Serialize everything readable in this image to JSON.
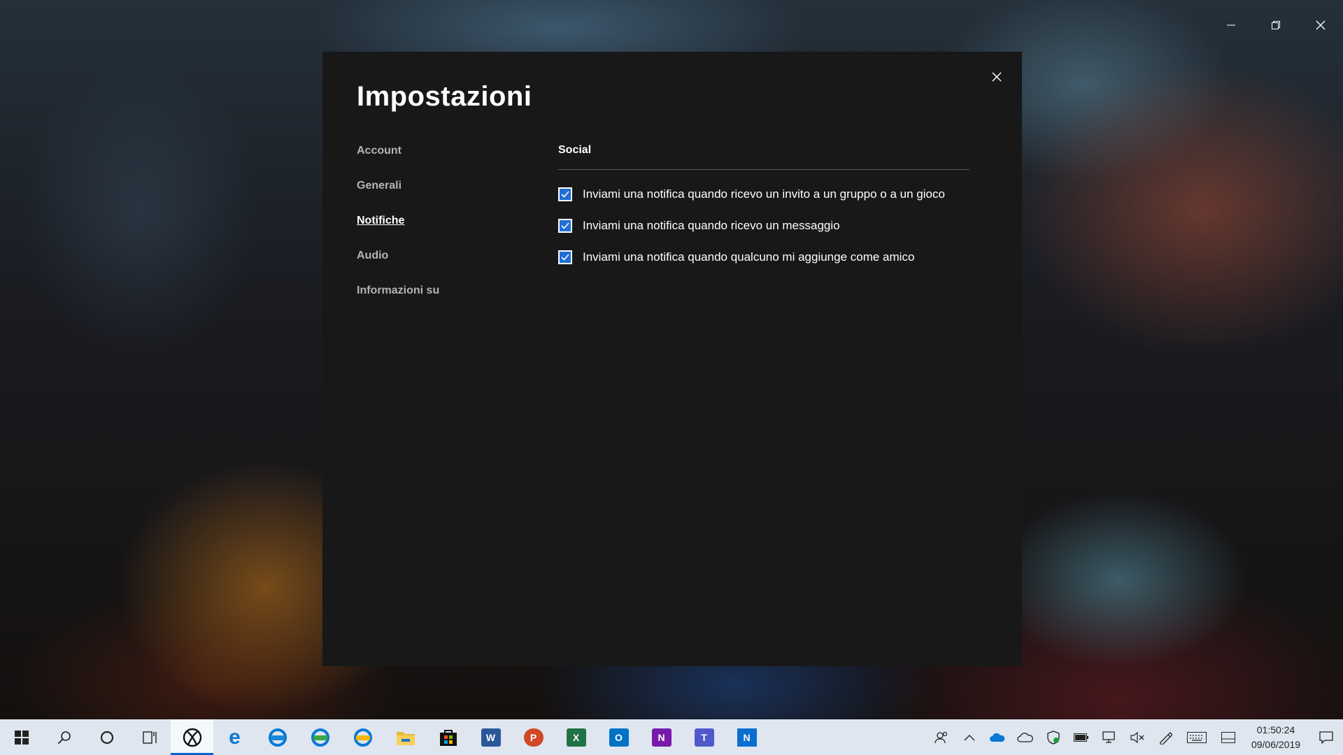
{
  "dialog": {
    "title": "Impostazioni",
    "nav": [
      {
        "label": "Account"
      },
      {
        "label": "Generali"
      },
      {
        "label": "Notifiche",
        "active": true
      },
      {
        "label": "Audio"
      },
      {
        "label": "Informazioni su"
      }
    ],
    "section": {
      "title": "Social",
      "options": [
        {
          "label": "Inviami una notifica quando ricevo un invito a un gruppo o a un gioco",
          "checked": true
        },
        {
          "label": "Inviami una notifica quando ricevo un messaggio",
          "checked": true
        },
        {
          "label": "Inviami una notifica quando qualcuno mi aggiunge come amico",
          "checked": true
        }
      ]
    }
  },
  "taskbar": {
    "apps": [
      {
        "name": "xbox-icon",
        "active": true
      },
      {
        "name": "edge-icon"
      },
      {
        "name": "edge-beta-icon"
      },
      {
        "name": "edge-dev-icon"
      },
      {
        "name": "edge-canary-icon"
      },
      {
        "name": "file-explorer-icon"
      },
      {
        "name": "store-icon"
      },
      {
        "name": "word-icon",
        "letter": "W",
        "color": "#2b579a"
      },
      {
        "name": "powerpoint-icon",
        "letter": "P",
        "color": "#d24726"
      },
      {
        "name": "excel-icon",
        "letter": "X",
        "color": "#217346"
      },
      {
        "name": "outlook-icon",
        "letter": "O",
        "color": "#0072c6"
      },
      {
        "name": "onenote-icon",
        "letter": "N",
        "color": "#7719aa"
      },
      {
        "name": "teams-icon",
        "letter": "T",
        "color": "#5059c9"
      },
      {
        "name": "news-icon",
        "letter": "N",
        "color": "#0a6ed1"
      }
    ],
    "clock": {
      "time": "01:50:24",
      "date": "09/06/2019"
    }
  },
  "colors": {
    "accent": "#1f6fd6",
    "dialog_bg": "#181818",
    "taskbar_bg": "#dfe6f0"
  }
}
